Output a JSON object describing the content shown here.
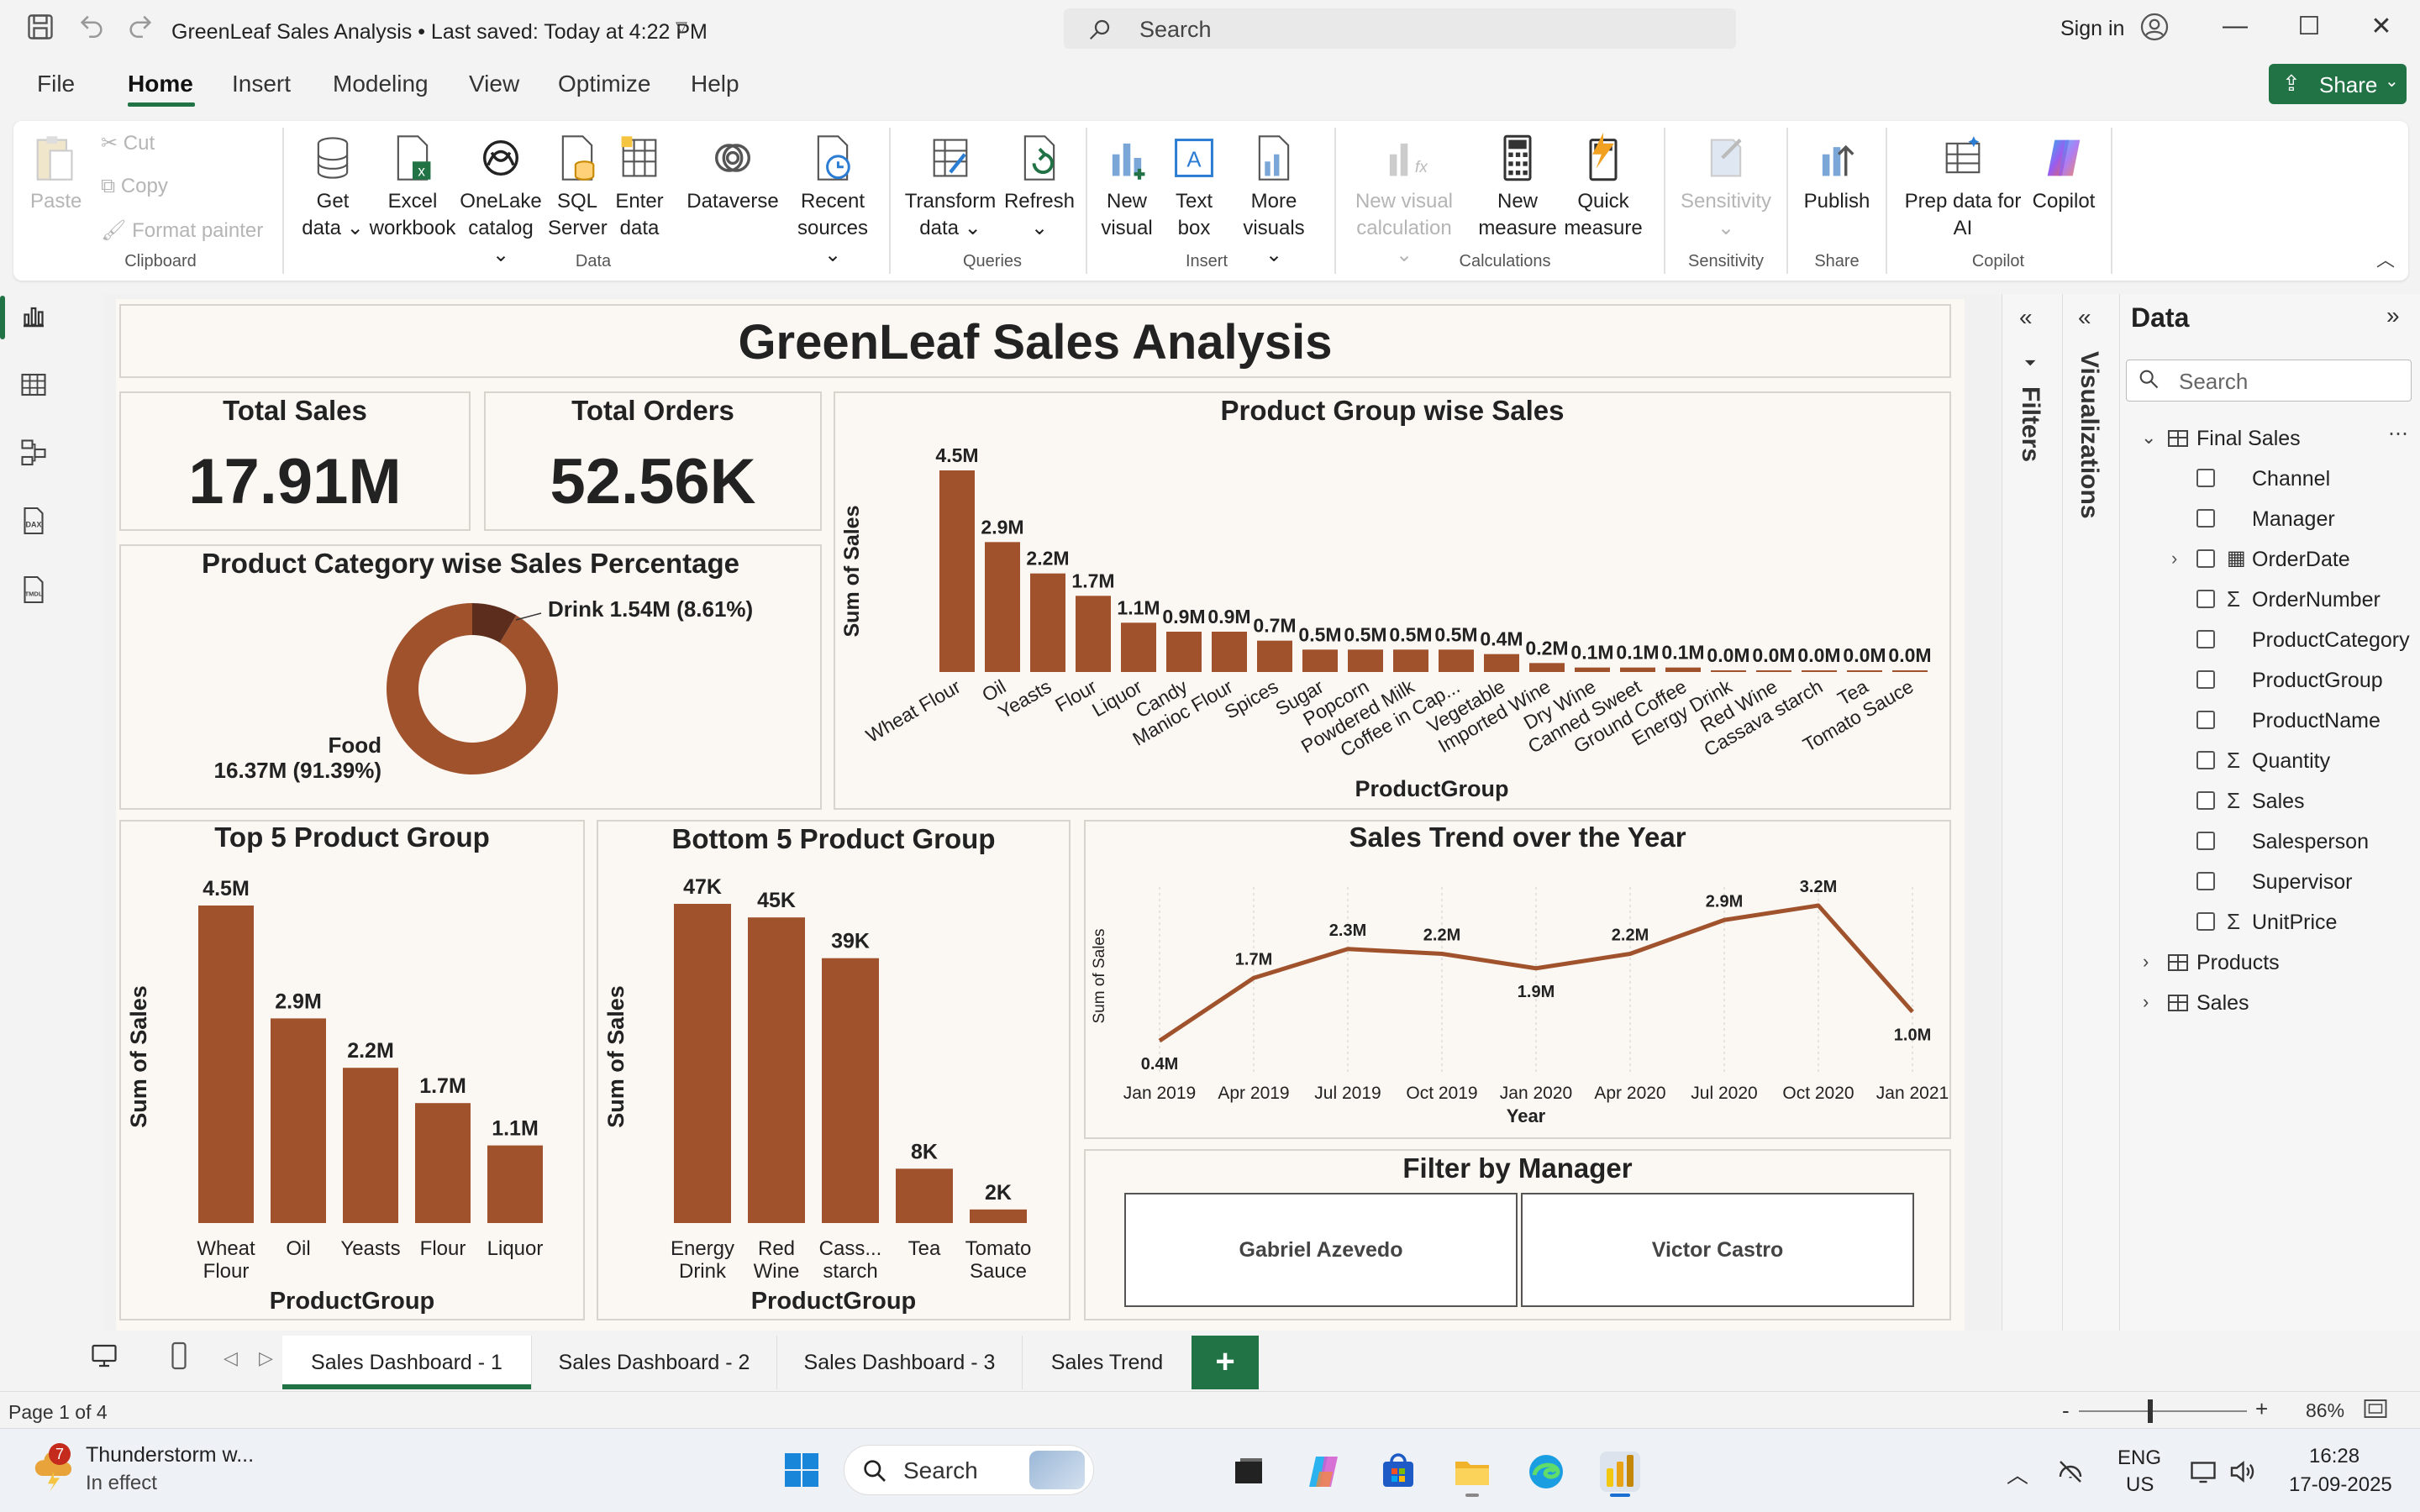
{
  "app": {
    "title": "GreenLeaf Sales Analysis • Last saved: Today at 4:22 PM",
    "search_placeholder": "Search",
    "sign_in": "Sign in",
    "share": "Share"
  },
  "menu": [
    "File",
    "Home",
    "Insert",
    "Modeling",
    "View",
    "Optimize",
    "Help"
  ],
  "ribbon": {
    "paste": "Paste",
    "cut": "Cut",
    "copy": "Copy",
    "format_painter": "Format painter",
    "clipboard": "Clipboard",
    "get_data": "Get",
    "get_data2": "data",
    "excel": "Excel",
    "excel2": "workbook",
    "onelake": "OneLake",
    "onelake2": "catalog",
    "sql": "SQL",
    "sql2": "Server",
    "enter": "Enter",
    "enter2": "data",
    "dataverse": "Dataverse",
    "recent": "Recent",
    "recent2": "sources",
    "data_group": "Data",
    "transform": "Transform",
    "transform2": "data",
    "refresh": "Refresh",
    "queries": "Queries",
    "new_visual": "New",
    "new_visual2": "visual",
    "text_box": "Text",
    "text_box2": "box",
    "more_visuals": "More",
    "more_visuals2": "visuals",
    "insert": "Insert",
    "new_vis_calc": "New visual",
    "new_vis_calc2": "calculation",
    "new_measure": "New",
    "new_measure2": "measure",
    "quick_measure": "Quick",
    "quick_measure2": "measure",
    "calculations": "Calculations",
    "sensitivity": "Sensitivity",
    "sensitivity_group": "Sensitivity",
    "publish": "Publish",
    "share_group": "Share",
    "prep_data": "Prep data for",
    "prep_data2": "AI",
    "copilot": "Copilot",
    "copilot_group": "Copilot"
  },
  "report": {
    "title": "GreenLeaf Sales Analysis",
    "kpi_sales_label": "Total Sales",
    "kpi_sales_value": "17.91M",
    "kpi_orders_label": "Total Orders",
    "kpi_orders_value": "52.56K",
    "filter_title": "Filter by Manager",
    "managers": [
      "Gabriel Azevedo",
      "Victor Castro"
    ]
  },
  "chart_data": [
    {
      "type": "pie",
      "title": "Product Category wise Sales Percentage",
      "slices": [
        {
          "name": "Drink",
          "value": 1.54,
          "label": "Drink 1.54M (8.61%)",
          "percent": 8.61
        },
        {
          "name": "Food",
          "value": 16.37,
          "label": "Food",
          "label2": "16.37M (91.39%)",
          "percent": 91.39
        }
      ],
      "colors": [
        "#5c2d1c",
        "#a0522d"
      ]
    },
    {
      "type": "bar",
      "title": "Product Group wise Sales",
      "xlabel": "ProductGroup",
      "ylabel": "Sum of Sales",
      "categories": [
        "Wheat Flour",
        "Oil",
        "Yeasts",
        "Flour",
        "Liquor",
        "Candy",
        "Manioc Flour",
        "Spices",
        "Sugar",
        "Popcorn",
        "Powdered Milk",
        "Coffee in Cap...",
        "Vegetable",
        "Imported Wine",
        "Dry Wine",
        "Canned Sweet",
        "Ground Coffee",
        "Energy Drink",
        "Red Wine",
        "Cassava starch",
        "Tea",
        "Tomato Sauce"
      ],
      "values": [
        4.5,
        2.9,
        2.2,
        1.7,
        1.1,
        0.9,
        0.9,
        0.7,
        0.5,
        0.5,
        0.5,
        0.5,
        0.4,
        0.2,
        0.1,
        0.1,
        0.1,
        0.0,
        0.0,
        0.0,
        0.0,
        0.0
      ],
      "labels": [
        "4.5M",
        "2.9M",
        "2.2M",
        "1.7M",
        "1.1M",
        "0.9M",
        "0.9M",
        "0.7M",
        "0.5M",
        "0.5M",
        "0.5M",
        "0.5M",
        "0.4M",
        "0.2M",
        "0.1M",
        "0.1M",
        "0.1M",
        "0.0M",
        "0.0M",
        "0.0M",
        "0.0M",
        "0.0M"
      ],
      "color": "#a0522d"
    },
    {
      "type": "bar",
      "title": "Top 5 Product Group",
      "xlabel": "ProductGroup",
      "ylabel": "Sum of Sales",
      "categories": [
        [
          "Wheat",
          "Flour"
        ],
        [
          "Oil"
        ],
        [
          "Yeasts"
        ],
        [
          "Flour"
        ],
        [
          "Liquor"
        ]
      ],
      "values": [
        4.5,
        2.9,
        2.2,
        1.7,
        1.1
      ],
      "labels": [
        "4.5M",
        "2.9M",
        "2.2M",
        "1.7M",
        "1.1M"
      ],
      "color": "#a0522d"
    },
    {
      "type": "bar",
      "title": "Bottom 5 Product Group",
      "xlabel": "ProductGroup",
      "ylabel": "Sum of Sales",
      "categories": [
        [
          "Energy",
          "Drink"
        ],
        [
          "Red",
          "Wine"
        ],
        [
          "Cass...",
          "starch"
        ],
        [
          "Tea"
        ],
        [
          "Tomato",
          "Sauce"
        ]
      ],
      "values": [
        47,
        45,
        39,
        8,
        2
      ],
      "labels": [
        "47K",
        "45K",
        "39K",
        "8K",
        "2K"
      ],
      "color": "#a0522d"
    },
    {
      "type": "line",
      "title": "Sales Trend over the Year",
      "xlabel": "Year",
      "ylabel": "Sum of Sales",
      "x": [
        "Jan 2019",
        "Apr 2019",
        "Jul 2019",
        "Oct 2019",
        "Jan 2020",
        "Apr 2020",
        "Jul 2020",
        "Oct 2020",
        "Jan 2021"
      ],
      "values": [
        0.4,
        1.7,
        2.3,
        2.2,
        1.9,
        2.2,
        2.9,
        3.2,
        1.0
      ],
      "labels": [
        "0.4M",
        "1.7M",
        "2.3M",
        "2.2M",
        "1.9M",
        "2.2M",
        "2.9M",
        "3.2M",
        "1.0M"
      ],
      "color": "#a0522d"
    }
  ],
  "panes": {
    "filters": "Filters",
    "visualizations": "Visualizations",
    "data": "Data",
    "search_placeholder": "Search",
    "tables": [
      {
        "name": "Final Sales",
        "expanded": true,
        "fields": [
          {
            "name": "Channel",
            "icon": "none"
          },
          {
            "name": "Manager",
            "icon": "none"
          },
          {
            "name": "OrderDate",
            "icon": "calendar-icon",
            "expandable": true
          },
          {
            "name": "OrderNumber",
            "icon": "sigma-icon"
          },
          {
            "name": "ProductCategory",
            "icon": "none"
          },
          {
            "name": "ProductGroup",
            "icon": "none"
          },
          {
            "name": "ProductName",
            "icon": "none"
          },
          {
            "name": "Quantity",
            "icon": "sigma-icon"
          },
          {
            "name": "Sales",
            "icon": "sigma-icon"
          },
          {
            "name": "Salesperson",
            "icon": "none"
          },
          {
            "name": "Supervisor",
            "icon": "none"
          },
          {
            "name": "UnitPrice",
            "icon": "sigma-icon"
          }
        ]
      },
      {
        "name": "Products",
        "expanded": false
      },
      {
        "name": "Sales",
        "expanded": false
      }
    ]
  },
  "tabs": [
    "Sales Dashboard - 1",
    "Sales Dashboard - 2",
    "Sales Dashboard - 3",
    "Sales Trend"
  ],
  "status": {
    "page": "Page 1 of 4",
    "zoom": "86%"
  },
  "taskbar": {
    "weather_title": "Thunderstorm w...",
    "weather_sub": "In effect",
    "weather_badge": "7",
    "search": "Search",
    "lang": "ENG",
    "region": "US",
    "time": "16:28",
    "date": "17-09-2025"
  }
}
